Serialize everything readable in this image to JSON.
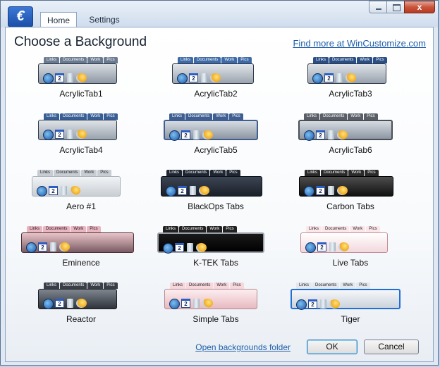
{
  "window": {
    "tabs": [
      {
        "label": "Home",
        "active": true
      },
      {
        "label": "Settings",
        "active": false
      }
    ],
    "close_glyph": "x"
  },
  "main": {
    "title": "Choose a Background",
    "find_more_link": "Find more at WinCustomize.com",
    "thumbnail_tabs": [
      "Links",
      "Documents",
      "Work",
      "Pics"
    ],
    "calendar_day": "2",
    "backgrounds": [
      {
        "label": "AcrylicTab1",
        "style": "acrylic1"
      },
      {
        "label": "AcrylicTab2",
        "style": "acrylic2"
      },
      {
        "label": "AcrylicTab3",
        "style": "acrylic3"
      },
      {
        "label": "AcrylicTab4",
        "style": "acrylic4"
      },
      {
        "label": "AcrylicTab5",
        "style": "acrylic5"
      },
      {
        "label": "AcrylicTab6",
        "style": "acrylic6"
      },
      {
        "label": "Aero #1",
        "style": "aero"
      },
      {
        "label": "BlackOps Tabs",
        "style": "blackops"
      },
      {
        "label": "Carbon Tabs",
        "style": "carbon"
      },
      {
        "label": "Eminence",
        "style": "eminence"
      },
      {
        "label": "K-TEK Tabs",
        "style": "ktek"
      },
      {
        "label": "Live Tabs",
        "style": "live"
      },
      {
        "label": "Reactor",
        "style": "reactor"
      },
      {
        "label": "Simple Tabs",
        "style": "simple"
      },
      {
        "label": "Tiger",
        "style": "tiger"
      }
    ]
  },
  "footer": {
    "open_folder_link": "Open backgrounds folder",
    "ok_label": "OK",
    "cancel_label": "Cancel"
  },
  "colors": {
    "link": "#1f5ea8",
    "title_bar": "#cfdced",
    "close_button": "#c9553d"
  },
  "icons": [
    "app-orb-icon",
    "minimize-icon",
    "maximize-icon",
    "close-icon",
    "windows-start-icon",
    "calendar-icon",
    "recycle-bin-icon",
    "weather-icon"
  ]
}
